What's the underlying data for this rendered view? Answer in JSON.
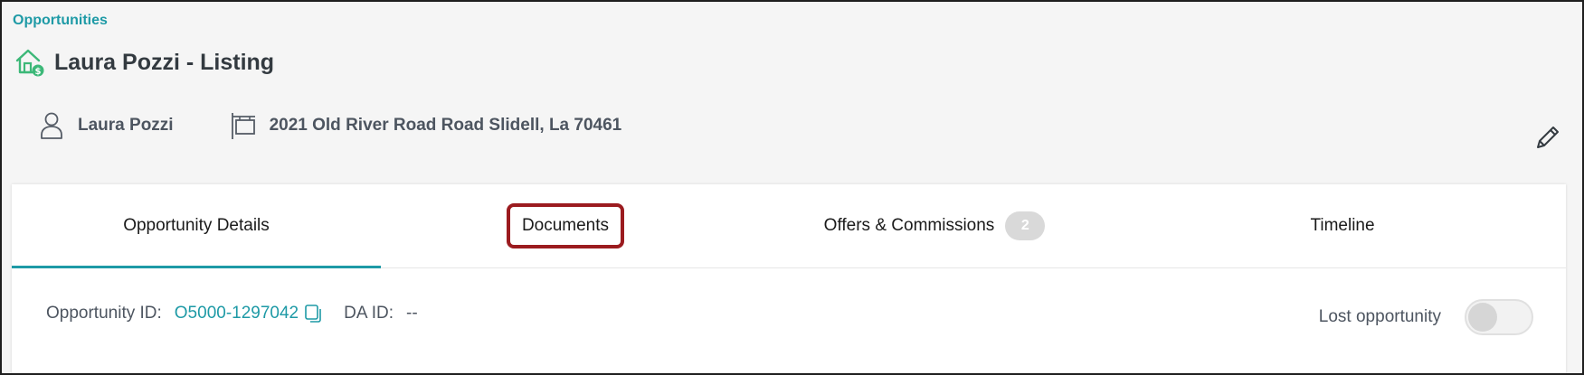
{
  "breadcrumb": {
    "label": "Opportunities"
  },
  "header": {
    "title": "Laura Pozzi - Listing",
    "icon": "house-dollar-icon",
    "accent_color": "#3cb878"
  },
  "meta": {
    "contact_name": "Laura Pozzi",
    "address": "2021 Old River Road Road Slidell, La 70461"
  },
  "tabs": [
    {
      "label": "Opportunity Details",
      "active": true
    },
    {
      "label": "Documents",
      "highlighted": true
    },
    {
      "label": "Offers & Commissions",
      "badge": "2"
    },
    {
      "label": "Timeline"
    }
  ],
  "details": {
    "opportunity_id_label": "Opportunity ID:",
    "opportunity_id_value": "O5000-1297042",
    "da_id_label": "DA ID:",
    "da_id_value": "--",
    "lost_label": "Lost opportunity",
    "lost_toggle_on": false
  },
  "colors": {
    "link": "#1e9aa6",
    "highlight_border": "#9b1b1f",
    "badge_bg": "#d9d9d9"
  }
}
